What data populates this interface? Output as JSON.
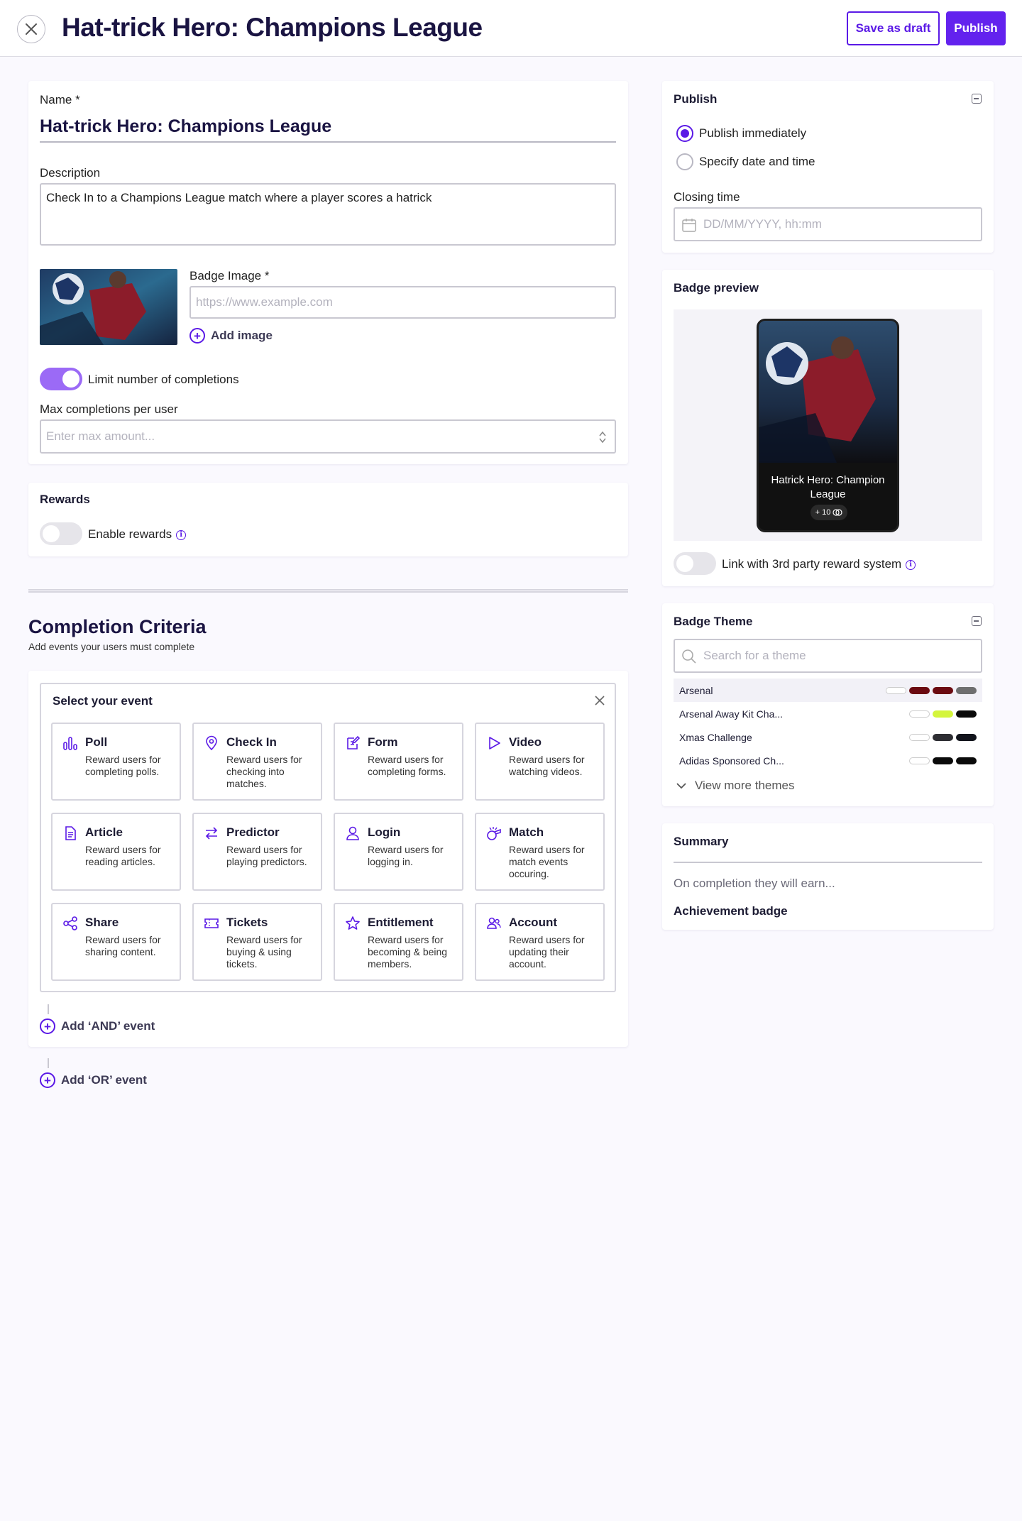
{
  "header": {
    "title": "Hat-trick Hero: Champions League",
    "save_draft_label": "Save as draft",
    "publish_label": "Publish"
  },
  "details": {
    "name_label": "Name *",
    "name_value": "Hat-trick Hero: Champions League",
    "description_label": "Description",
    "description_value": "Check In to a Champions League match where a player scores a hatrick",
    "badge_image_label": "Badge Image *",
    "badge_image_placeholder": "https://www.example.com",
    "add_image_label": "Add image",
    "limit_toggle_label": "Limit number of completions",
    "limit_toggle_on": true,
    "max_completions_label": "Max completions per user",
    "max_completions_placeholder": "Enter max amount..."
  },
  "rewards": {
    "title": "Rewards",
    "enable_label": "Enable rewards",
    "enabled": false
  },
  "criteria": {
    "title": "Completion Criteria",
    "subtitle": "Add events your users must complete",
    "panel_title": "Select your event",
    "events": [
      {
        "title": "Poll",
        "desc": "Reward users for completing polls.",
        "icon": "poll-icon"
      },
      {
        "title": "Check In",
        "desc": "Reward users for checking into matches.",
        "icon": "location-pin-icon"
      },
      {
        "title": "Form",
        "desc": "Reward users for completing forms.",
        "icon": "form-edit-icon"
      },
      {
        "title": "Video",
        "desc": "Reward users for watching videos.",
        "icon": "play-icon"
      },
      {
        "title": "Article",
        "desc": "Reward users for reading articles.",
        "icon": "document-icon"
      },
      {
        "title": "Predictor",
        "desc": "Reward users for playing predictors.",
        "icon": "swap-arrows-icon"
      },
      {
        "title": "Login",
        "desc": "Reward users for logging in.",
        "icon": "user-icon"
      },
      {
        "title": "Match",
        "desc": "Reward users for match events occuring.",
        "icon": "whistle-icon"
      },
      {
        "title": "Share",
        "desc": "Reward users for sharing content.",
        "icon": "share-icon"
      },
      {
        "title": "Tickets",
        "desc": "Reward users for buying & using tickets.",
        "icon": "ticket-icon"
      },
      {
        "title": "Entitlement",
        "desc": "Reward users for becoming & being members.",
        "icon": "star-icon"
      },
      {
        "title": "Account",
        "desc": "Reward users for updating their account.",
        "icon": "users-icon"
      }
    ],
    "add_and_label": "Add ‘AND’ event",
    "add_or_label": "Add ‘OR’ event"
  },
  "publish": {
    "title": "Publish",
    "option_immediately": "Publish immediately",
    "option_schedule": "Specify date and time",
    "selected": "immediately",
    "closing_label": "Closing time",
    "closing_placeholder": "DD/MM/YYYY, hh:mm"
  },
  "preview": {
    "title": "Badge preview",
    "badge_title": "Hatrick Hero: Champion League",
    "badge_points": "+ 10",
    "link_label": "Link with 3rd party reward system",
    "link_enabled": false
  },
  "theme": {
    "title": "Badge Theme",
    "search_placeholder": "Search for a theme",
    "themes": [
      {
        "name": "Arsenal",
        "colors": [
          "#ffffff",
          "#6b0a10",
          "#6b0a10",
          "#6e6e6e"
        ]
      },
      {
        "name": "Arsenal Away Kit Cha...",
        "colors": [
          "#ffffff",
          "#d4f53c",
          "#0a0a0a"
        ]
      },
      {
        "name": "Xmas Challenge",
        "colors": [
          "#ffffff",
          "#2e2e33",
          "#12141c"
        ]
      },
      {
        "name": "Adidas Sponsored Ch...",
        "colors": [
          "#ffffff",
          "#0a0a0a",
          "#0a0a0a"
        ]
      }
    ],
    "view_more_label": "View more themes"
  },
  "summary": {
    "title": "Summary",
    "earn_label": "On completion they will earn...",
    "earn_value": "Achievement badge"
  },
  "colors": {
    "accent": "#5a19e6",
    "toggle_on": "#9b6af6",
    "title_ink": "#1a1442"
  }
}
